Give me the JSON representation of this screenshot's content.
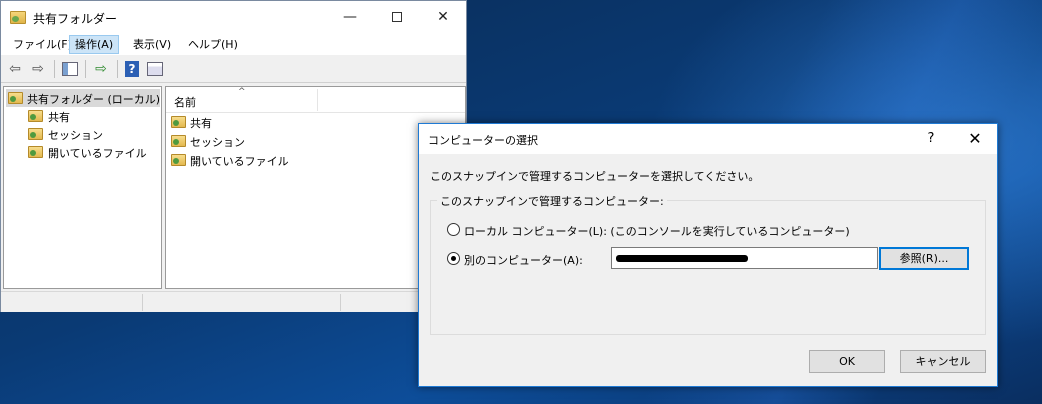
{
  "main_window": {
    "title": "共有フォルダー",
    "min_glyph": "—",
    "close_glyph": "✕",
    "menu": [
      "ファイル(F)",
      "操作(A)",
      "表示(V)",
      "ヘルプ(H)"
    ],
    "active_menu_index": 1,
    "toolbar": {
      "back_glyph": "⇦",
      "forward_glyph": "⇨",
      "export_glyph": "⇨",
      "help_glyph": "?"
    },
    "tree": {
      "root": "共有フォルダー (ローカル)",
      "items": [
        "共有",
        "セッション",
        "開いているファイル"
      ]
    },
    "list": {
      "column_header": "名前",
      "sort_glyph": "^",
      "items": [
        "共有",
        "セッション",
        "開いているファイル"
      ]
    }
  },
  "dialog": {
    "title": "コンピューターの選択",
    "help_glyph": "?",
    "close_glyph": "✕",
    "description": "このスナップインで管理するコンピューターを選択してください。",
    "group_label": "このスナップインで管理するコンピューター:",
    "radio_local_label": "ローカル コンピューター(L): (このコンソールを実行しているコンピューター)",
    "radio_other_label": "別のコンピューター(A):",
    "selected_option": "other",
    "computer_name_value": "",
    "browse_button": "参照(R)...",
    "ok_button": "OK",
    "cancel_button": "キャンセル"
  },
  "colors": {
    "accent": "#0078d7",
    "menu_active_bg": "#cce4f7",
    "desktop": "#0a3a74"
  }
}
